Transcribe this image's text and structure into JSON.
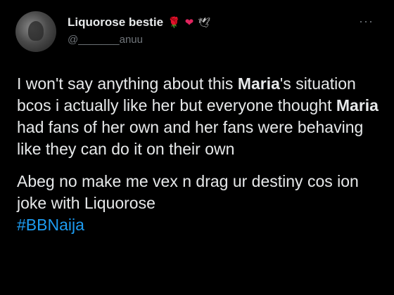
{
  "author": {
    "display_name": "Liquorose bestie",
    "emojis": [
      "🌹",
      "❤",
      "🕊"
    ],
    "handle": "@_______anuu"
  },
  "menu": {
    "more_label": "···"
  },
  "tweet": {
    "p1": {
      "t1": "I won't say anything about this ",
      "b1": "Maria",
      "t2": "'s situation bcos i actually like her but everyone thought ",
      "b2": "Maria",
      "t3": " had fans of her own and her fans were behaving like they can do it on their own"
    },
    "p2": {
      "t1": "Abeg no make me vex n drag ur destiny cos ion joke with Liquorose",
      "hashtag": "#BBNaija"
    }
  },
  "colors": {
    "background": "#000000",
    "text": "#e7e9ea",
    "secondary": "#71767b",
    "hashtag": "#1d9bf0"
  }
}
